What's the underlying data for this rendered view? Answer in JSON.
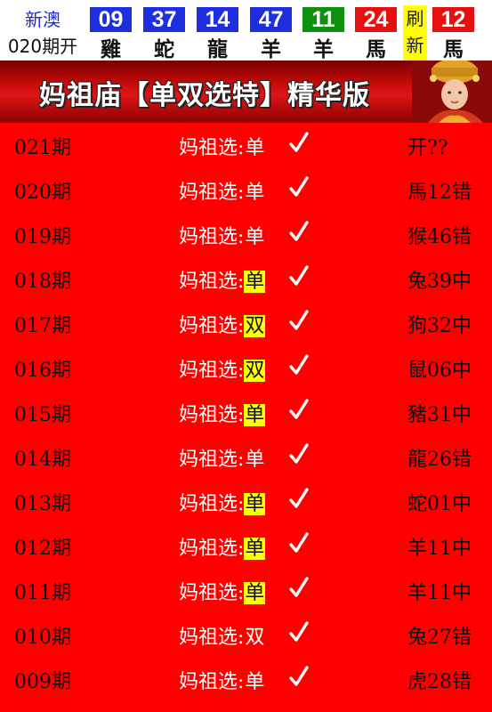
{
  "header": {
    "brand_line1": "新澳",
    "brand_line2": "020期开",
    "balls": [
      {
        "number": "09",
        "zodiac": "雞",
        "color": "#1f2fe0"
      },
      {
        "number": "37",
        "zodiac": "蛇",
        "color": "#1f2fe0"
      },
      {
        "number": "14",
        "zodiac": "龍",
        "color": "#1f2fe0"
      },
      {
        "number": "47",
        "zodiac": "羊",
        "color": "#1f2fe0"
      },
      {
        "number": "11",
        "zodiac": "羊",
        "color": "#109010"
      },
      {
        "number": "24",
        "zodiac": "馬",
        "color": "#e51010"
      },
      {
        "number": "12",
        "zodiac": "馬",
        "color": "#e51010"
      }
    ],
    "refresh_top": "刷",
    "refresh_bottom": "新"
  },
  "banner": {
    "title": "妈祖庙【单双选特】精华版"
  },
  "colors": {
    "background": "#ff0000",
    "highlight": "#ffff00"
  },
  "rows": [
    {
      "period": "021期",
      "label": "妈祖选:",
      "value": "单",
      "highlight": false,
      "result": "开??"
    },
    {
      "period": "020期",
      "label": "妈祖选:",
      "value": "单",
      "highlight": false,
      "result": "馬12错"
    },
    {
      "period": "019期",
      "label": "妈祖选:",
      "value": "单",
      "highlight": false,
      "result": "猴46错"
    },
    {
      "period": "018期",
      "label": "妈祖选:",
      "value": "单",
      "highlight": true,
      "result": "兔39中"
    },
    {
      "period": "017期",
      "label": "妈祖选:",
      "value": "双",
      "highlight": true,
      "result": "狗32中"
    },
    {
      "period": "016期",
      "label": "妈祖选:",
      "value": "双",
      "highlight": true,
      "result": "鼠06中"
    },
    {
      "period": "015期",
      "label": "妈祖选:",
      "value": "单",
      "highlight": true,
      "result": "豬31中"
    },
    {
      "period": "014期",
      "label": "妈祖选:",
      "value": "单",
      "highlight": false,
      "result": "龍26错"
    },
    {
      "period": "013期",
      "label": "妈祖选:",
      "value": "单",
      "highlight": true,
      "result": "蛇01中"
    },
    {
      "period": "012期",
      "label": "妈祖选:",
      "value": "单",
      "highlight": true,
      "result": "羊11中"
    },
    {
      "period": "011期",
      "label": "妈祖选:",
      "value": "单",
      "highlight": true,
      "result": "羊11中"
    },
    {
      "period": "010期",
      "label": "妈祖选:",
      "value": "双",
      "highlight": false,
      "result": "兔27错"
    },
    {
      "period": "009期",
      "label": "妈祖选:",
      "value": "单",
      "highlight": false,
      "result": "虎28错"
    }
  ],
  "icons": {
    "check": "checkmark-icon",
    "portrait": "mazu-portrait-icon"
  }
}
